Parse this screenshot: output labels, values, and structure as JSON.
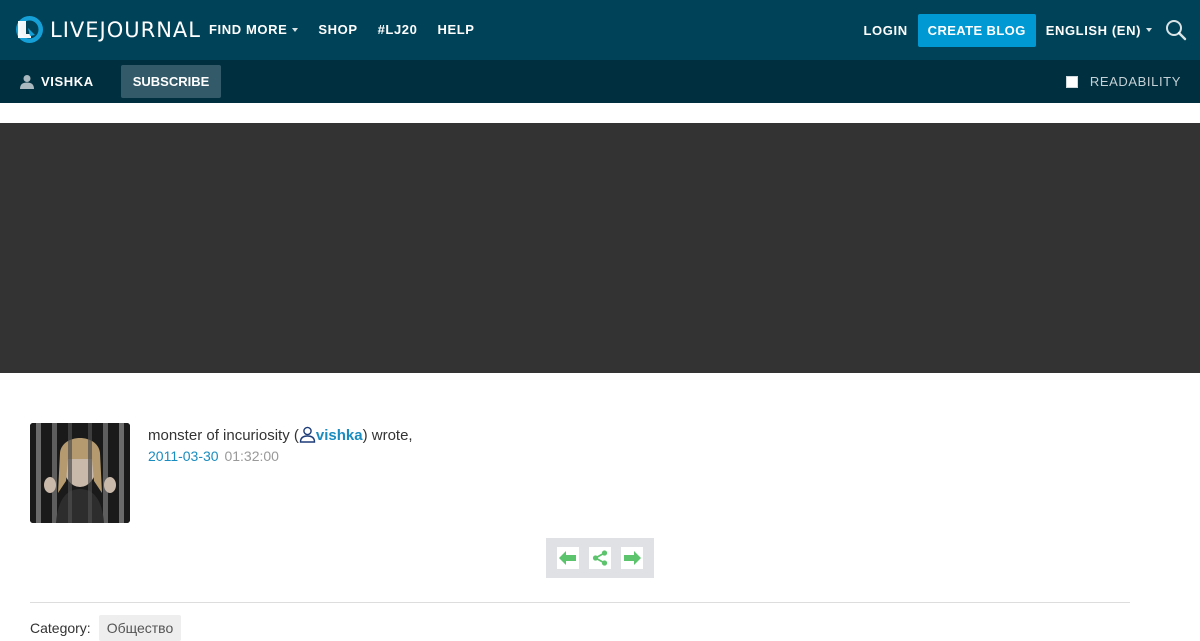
{
  "brand": {
    "name": "LIVEJOURNAL"
  },
  "nav": [
    {
      "label": "FIND MORE",
      "has_dropdown": true
    },
    {
      "label": "SHOP"
    },
    {
      "label": "#LJ20"
    },
    {
      "label": "HELP"
    }
  ],
  "header_right": {
    "login_label": "LOGIN",
    "create_blog_label": "CREATE BLOG",
    "language_label": "ENGLISH (EN)"
  },
  "subbar": {
    "username": "VISHKA",
    "subscribe_label": "SUBSCRIBE",
    "readability_label": "READABILITY"
  },
  "entry": {
    "author_name": "monster of incuriosity",
    "author_link": "vishka",
    "wrote_suffix": ") wrote,",
    "open_paren": " (",
    "date": "2011-03-30",
    "time": "01:32:00"
  },
  "category": {
    "label": "Category:",
    "tag": "Общество"
  },
  "icons": [
    "livejournal-logo-icon",
    "chevron-down-icon",
    "search-icon",
    "user-icon",
    "ljuser-icon",
    "arrow-left-icon",
    "share-icon",
    "arrow-right-icon"
  ],
  "colors": {
    "topbar": "#004359",
    "subbar": "#00303f",
    "accent": "#0099d3",
    "link": "#1a8cbf",
    "banner": "#333333",
    "control_green": "#5cc46c"
  }
}
